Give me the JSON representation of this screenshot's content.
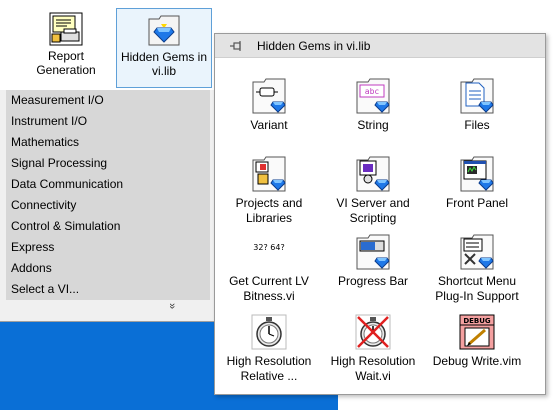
{
  "palette": {
    "top_icons": [
      {
        "label": "Report Generation",
        "name": "report-generation"
      },
      {
        "label": "Hidden Gems in vi.lib",
        "name": "hidden-gems"
      }
    ],
    "categories": [
      "Measurement I/O",
      "Instrument I/O",
      "Mathematics",
      "Signal Processing",
      "Data Communication",
      "Connectivity",
      "Control & Simulation",
      "Express",
      "Addons",
      "Select a VI..."
    ],
    "expand_glyph": "»"
  },
  "subpalette": {
    "title": "Hidden Gems in vi.lib",
    "tiles": [
      {
        "label": "Variant",
        "icon": "variant-icon"
      },
      {
        "label": "String",
        "icon": "string-icon"
      },
      {
        "label": "Files",
        "icon": "files-icon"
      },
      {
        "label": "Projects and Libraries",
        "icon": "projects-icon"
      },
      {
        "label": "VI Server and Scripting",
        "icon": "vi-server-icon"
      },
      {
        "label": "Front Panel",
        "icon": "front-panel-icon"
      },
      {
        "label": "Get Current LV Bitness.vi",
        "icon": "bitness-icon",
        "glyph": "32? 64?"
      },
      {
        "label": "Progress Bar",
        "icon": "progress-bar-icon"
      },
      {
        "label": "Shortcut Menu Plug-In Support",
        "icon": "shortcut-menu-icon"
      },
      {
        "label": "High Resolution Relative ...",
        "icon": "stopwatch-icon"
      },
      {
        "label": "High Resolution Wait.vi",
        "icon": "wait-icon"
      },
      {
        "label": "Debug Write.vim",
        "icon": "debug-icon",
        "glyph": "DEBUG"
      }
    ]
  }
}
